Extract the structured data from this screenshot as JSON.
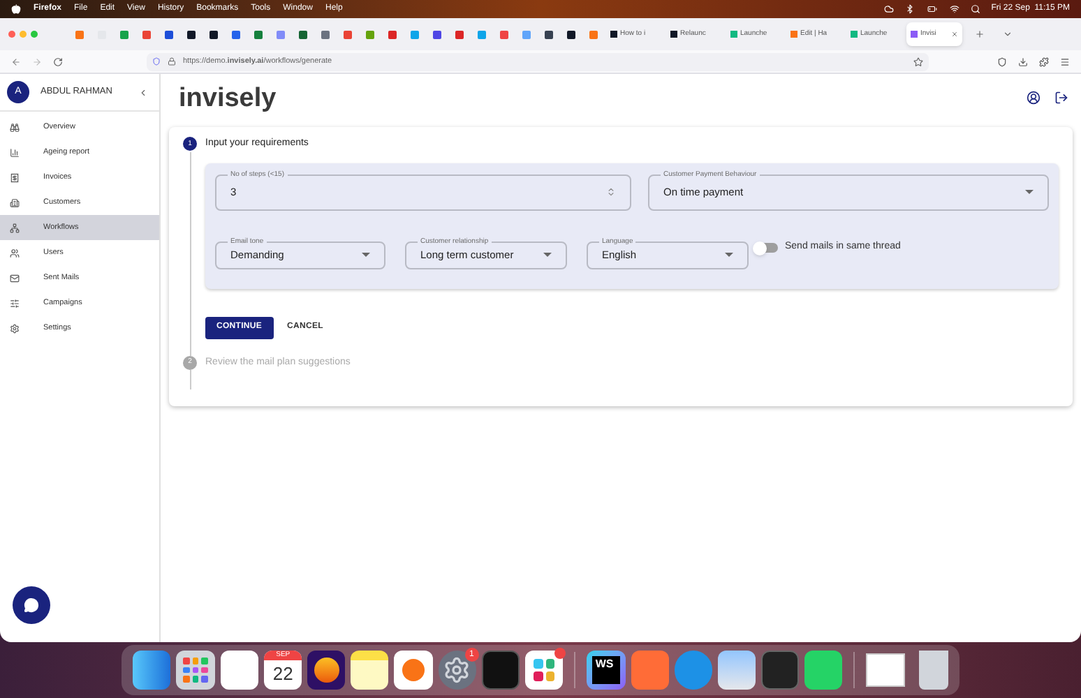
{
  "menubar": {
    "app": "Firefox",
    "menus": [
      "File",
      "Edit",
      "View",
      "History",
      "Bookmarks",
      "Tools",
      "Window",
      "Help"
    ],
    "clock": "Fri 22 Sep  11:15 PM"
  },
  "browser": {
    "tabs": [
      {
        "label": "How to i",
        "selected": false
      },
      {
        "label": "Relaunc",
        "selected": false
      },
      {
        "label": "Launche",
        "selected": false
      },
      {
        "label": "Edit | Ha",
        "selected": false
      },
      {
        "label": "Launche",
        "selected": false
      },
      {
        "label": "Invisi",
        "selected": true
      }
    ],
    "url": "https://demo.**invisely.ai**/workflows/generate"
  },
  "sidebar": {
    "user": {
      "initial": "A",
      "name": "ABDUL RAHMAN"
    },
    "items": [
      {
        "label": "Overview",
        "selected": false
      },
      {
        "label": "Ageing report",
        "selected": false
      },
      {
        "label": "Invoices",
        "selected": false
      },
      {
        "label": "Customers",
        "selected": false
      },
      {
        "label": "Workflows",
        "selected": true
      },
      {
        "label": "Users",
        "selected": false
      },
      {
        "label": "Sent Mails",
        "selected": false
      },
      {
        "label": "Campaigns",
        "selected": false
      },
      {
        "label": "Settings",
        "selected": false
      }
    ]
  },
  "logo": "invisely",
  "steps": [
    {
      "number": "1",
      "label": "Input your requirements",
      "active": true
    },
    {
      "number": "2",
      "label": "Review the mail plan suggestions",
      "active": false
    }
  ],
  "form": {
    "row_1": [
      {
        "kind": "number",
        "label": "No of steps (<15)",
        "value": "3"
      },
      {
        "kind": "select",
        "label": "Customer Payment Behaviour",
        "value": "On time payment"
      }
    ],
    "row_2": [
      {
        "kind": "select",
        "label": "Email tone",
        "value": "Demanding"
      },
      {
        "kind": "select",
        "label": "Customer relationship",
        "value": "Long term customer"
      },
      {
        "kind": "select",
        "label": "Language",
        "value": "English"
      }
    ],
    "toggle": {
      "label": "Send mails in same thread",
      "on": false
    }
  },
  "buttons": {
    "continue": "CONTINUE",
    "cancel": "CANCEL"
  },
  "dock": {
    "calendar_month": "SEP",
    "calendar_day": "22",
    "ide_label": "WS",
    "badge": "1"
  }
}
